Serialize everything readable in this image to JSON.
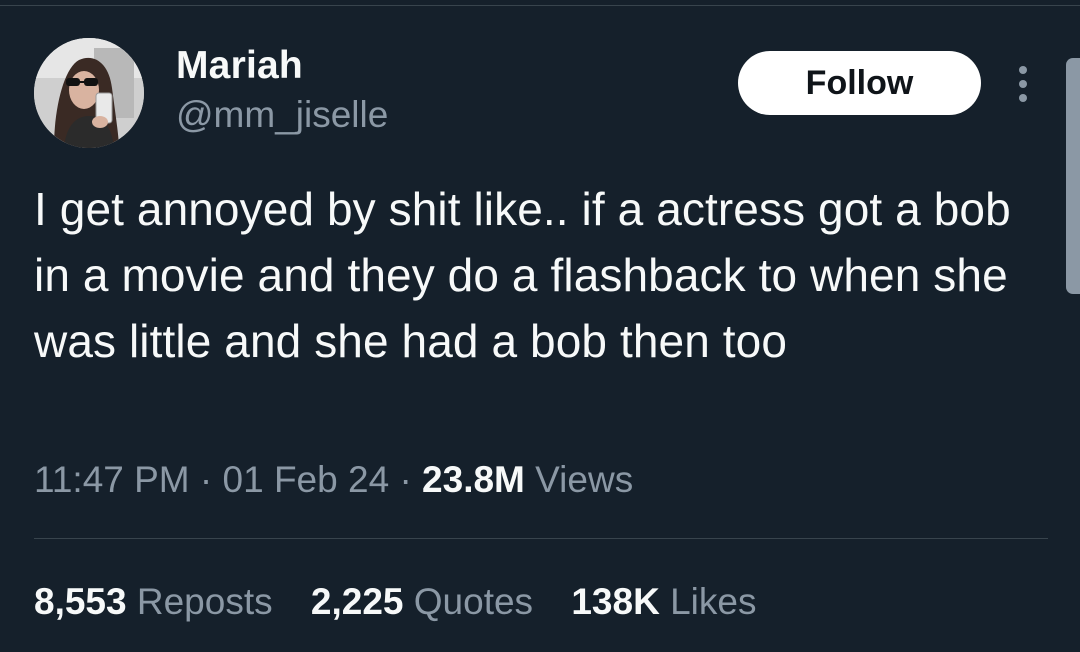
{
  "user": {
    "display_name": "Mariah",
    "handle": "@mm_jiselle",
    "avatar_icon": "profile-photo"
  },
  "actions": {
    "follow_label": "Follow",
    "more_icon": "more-vertical-icon"
  },
  "tweet": {
    "text": "I get annoyed by shit like.. if a actress got a bob in a movie and they do a flashback to when she was little and she had a bob then too"
  },
  "meta": {
    "time": "11:47 PM",
    "sep1": "·",
    "date": "01 Feb 24",
    "sep2": "·",
    "views_count": "23.8M",
    "views_label": "Views"
  },
  "stats": [
    {
      "count": "8,553",
      "label": "Reposts"
    },
    {
      "count": "2,225",
      "label": "Quotes"
    },
    {
      "count": "138K",
      "label": "Likes"
    }
  ],
  "colors": {
    "background": "#15202b",
    "primary_text": "#f7f9f9",
    "secondary_text": "#8b98a5",
    "divider": "#38444d",
    "button_bg": "#ffffff"
  }
}
